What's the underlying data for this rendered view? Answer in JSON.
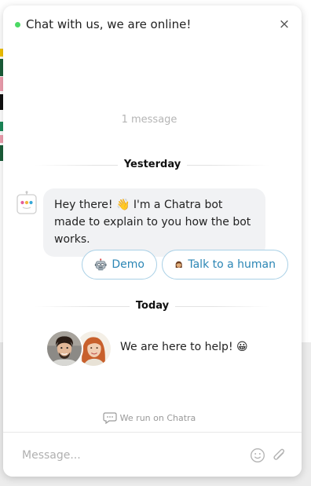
{
  "header": {
    "title": "Chat with us, we are online!",
    "status_color": "#4cd964",
    "close_icon": "×"
  },
  "conversation": {
    "message_count": "1 message",
    "days": [
      {
        "label": "Yesterday"
      },
      {
        "label": "Today"
      }
    ],
    "bot_message": "Hey there! 👋 I'm a Chatra bot made to explain to you how the bot works.",
    "quick_replies": [
      {
        "label": "Demo",
        "icon": "robot-icon"
      },
      {
        "label": "Talk to a human",
        "icon": "woman-icon"
      }
    ],
    "team_message": "We are here to help! 😀"
  },
  "footer": {
    "powered_by": "We run on Chatra"
  },
  "composer": {
    "placeholder": "Message..."
  },
  "colors": {
    "accent": "#2b86b5",
    "quick_reply_border": "#a9d0e6",
    "bubble_bg": "#f1f2f4"
  }
}
